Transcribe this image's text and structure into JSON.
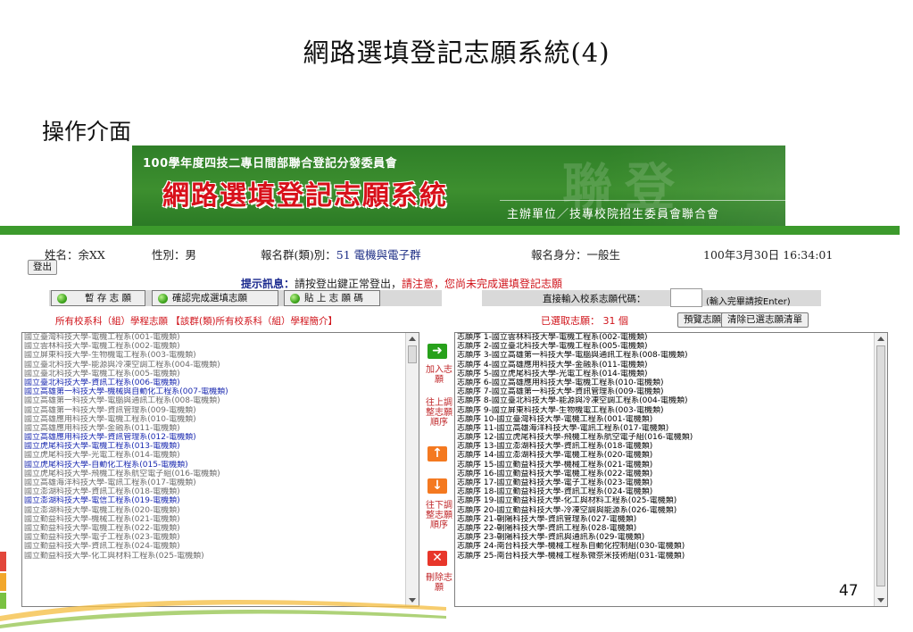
{
  "slide": {
    "title": "網路選填登記志願系統(4)",
    "section": "操作介面",
    "page_number": "47"
  },
  "banner": {
    "committee": "100學年度四技二專日間部聯合登記分發委員會",
    "system_name": "網路選填登記志願系統",
    "watermark": "聯登",
    "organizer": "主辦單位／技專校院招生委員會聯合會"
  },
  "user": {
    "name_label": "姓名：",
    "name_value": "余XX",
    "gender_label": "性別：",
    "gender_value": "男",
    "group_label": "報名群(類)別：",
    "group_value": "51 電機與電子群",
    "identity_label": "報名身分：",
    "identity_value": "一般生",
    "datetime": "100年3月30日 16:34:01",
    "logout_label": "登出"
  },
  "hint": {
    "label": "提示訊息：",
    "text_black": "請按登出鍵正常登出，",
    "text_red": "請注意，您尚未完成選填登記志願"
  },
  "toolbar": {
    "save_label": "暫 存 志 願",
    "confirm_label": "確認完成選填志願",
    "paste_label": "貼 上 志 願 碼",
    "direct_label": "直接輸入校系志願代碼：",
    "direct_value": "",
    "direct_note": "(輸入完畢請按Enter)"
  },
  "left_panel": {
    "header_prefix": "所有校系科（組）學程志願",
    "header_link": "【該群(類)所有校系科（組）學程簡介】",
    "items": [
      {
        "text": "國立臺灣科技大學-電機工程系(001-電機類)",
        "hl": false
      },
      {
        "text": "國立雲林科技大學-電機工程系(002-電機類)",
        "hl": false
      },
      {
        "text": "國立屏東科技大學-生物機電工程系(003-電機類)",
        "hl": false
      },
      {
        "text": "國立臺北科技大學-能源與冷凍空調工程系(004-電機類)",
        "hl": false
      },
      {
        "text": "國立臺北科技大學-電機工程系(005-電機類)",
        "hl": false
      },
      {
        "text": "國立臺北科技大學-資訊工程系(006-電機類)",
        "hl": true
      },
      {
        "text": "國立高雄第一科技大學-機械與自動化工程系(007-電機類)",
        "hl": true
      },
      {
        "text": "國立高雄第一科技大學-電腦與通訊工程系(008-電機類)",
        "hl": false
      },
      {
        "text": "國立高雄第一科技大學-資訊管理系(009-電機類)",
        "hl": false
      },
      {
        "text": "國立高雄應用科技大學-電機工程系(010-電機類)",
        "hl": false
      },
      {
        "text": "國立高雄應用科技大學-金融系(011-電機類)",
        "hl": false
      },
      {
        "text": "國立高雄應用科技大學-資訊管理系(012-電機類)",
        "hl": true
      },
      {
        "text": "國立虎尾科技大學-電機工程系(013-電機類)",
        "hl": true
      },
      {
        "text": "國立虎尾科技大學-光電工程系(014-電機類)",
        "hl": false
      },
      {
        "text": "國立虎尾科技大學-自動化工程系(015-電機類)",
        "hl": true
      },
      {
        "text": "國立虎尾科技大學-飛機工程系航空電子組(016-電機類)",
        "hl": false
      },
      {
        "text": "國立高雄海洋科技大學-電訊工程系(017-電機類)",
        "hl": false
      },
      {
        "text": "國立澎湖科技大學-資訊工程系(018-電機類)",
        "hl": false
      },
      {
        "text": "國立澎湖科技大學-電信工程系(019-電機類)",
        "hl": true
      },
      {
        "text": "國立澎湖科技大學-電機工程系(020-電機類)",
        "hl": false
      },
      {
        "text": "國立勤益科技大學-機械工程系(021-電機類)",
        "hl": false
      },
      {
        "text": "國立勤益科技大學-電機工程系(022-電機類)",
        "hl": false
      },
      {
        "text": "國立勤益科技大學-電子工程系(023-電機類)",
        "hl": false
      },
      {
        "text": "國立勤益科技大學-資訊工程系(024-電機類)",
        "hl": false
      },
      {
        "text": "國立勤益科技大學-化工與材料工程系(025-電機類)",
        "hl": false
      }
    ]
  },
  "actions": {
    "add_label": "加入志願",
    "up_label": "往上調整志願順序",
    "down_label": "往下調整志願順序",
    "delete_label": "刪除志願"
  },
  "right_panel": {
    "selected_count": "已選取志願： 31 個",
    "preview_label": "預覽志願",
    "clear_label": "清除已選志願清單",
    "items": [
      "志願序 1-國立雲林科技大學-電機工程系(002-電機類)",
      "志願序 2-國立臺北科技大學-電機工程系(005-電機類)",
      "志願序 3-國立高雄第一科技大學-電腦與通訊工程系(008-電機類)",
      "志願序 4-國立高雄應用科技大學-金融系(011-電機類)",
      "志願序 5-國立虎尾科技大學-光電工程系(014-電機類)",
      "志願序 6-國立高雄應用科技大學-電機工程系(010-電機類)",
      "志願序 7-國立高雄第一科技大學-資訊管理系(009-電機類)",
      "志願序 8-國立臺北科技大學-能源與冷凍空調工程系(004-電機類)",
      "志願序 9-國立屏東科技大學-生物機電工程系(003-電機類)",
      "志願序 10-國立臺灣科技大學-電機工程系(001-電機類)",
      "志願序 11-國立高雄海洋科技大學-電訊工程系(017-電機類)",
      "志願序 12-國立虎尾科技大學-飛機工程系航空電子組(016-電機類)",
      "志願序 13-國立澎湖科技大學-資訊工程系(018-電機類)",
      "志願序 14-國立澎湖科技大學-電機工程系(020-電機類)",
      "志願序 15-國立勤益科技大學-機械工程系(021-電機類)",
      "志願序 16-國立勤益科技大學-電機工程系(022-電機類)",
      "志願序 17-國立勤益科技大學-電子工程系(023-電機類)",
      "志願序 18-國立勤益科技大學-資訊工程系(024-電機類)",
      "志願序 19-國立勤益科技大學-化工與材料工程系(025-電機類)",
      "志願序 20-國立勤益科技大學-冷凍空調與能源系(026-電機類)",
      "志願序 21-朝陽科技大學-資訊管理系(027-電機類)",
      "志願序 22-朝陽科技大學-資訊工程系(028-電機類)",
      "志願序 23-朝陽科技大學-資訊與通訊系(029-電機類)",
      "志願序 24-南台科技大學-機械工程系自動化控制組(030-電機類)",
      "志願序 25-南台科技大學-機械工程系微奈米技術組(031-電機類)"
    ]
  }
}
